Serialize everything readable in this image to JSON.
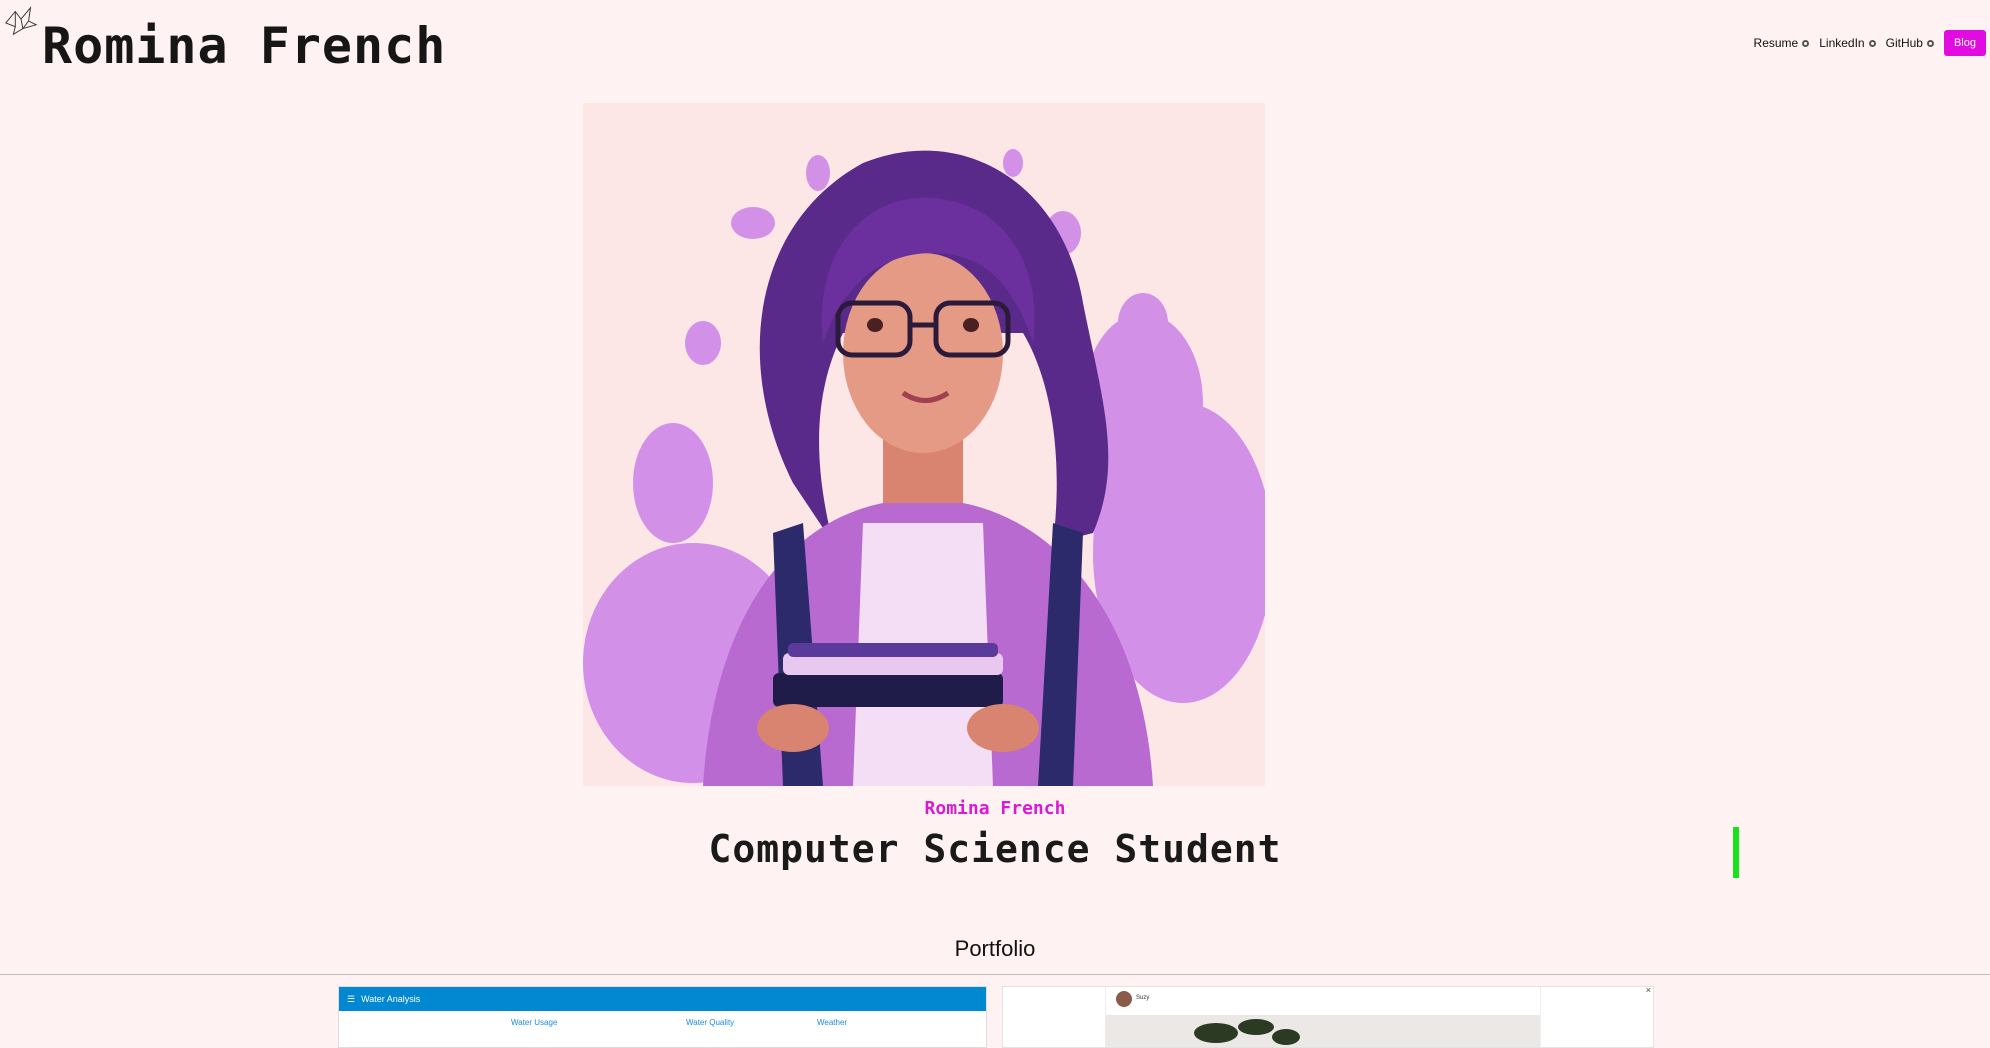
{
  "site": {
    "title": "Romina French"
  },
  "nav": {
    "resume": "Resume",
    "linkedin": "LinkedIn",
    "github": "GitHub",
    "blog": "Blog"
  },
  "hero": {
    "name": "Romina French",
    "role": "Computer Science Student"
  },
  "portfolio": {
    "heading": "Portfolio",
    "card1": {
      "title": "Water Analysis",
      "tabs": [
        "Water Usage",
        "Water Quality",
        "Weather"
      ]
    },
    "card2": {
      "username": "Suzy"
    }
  },
  "colors": {
    "background": "#fff2f3",
    "accent": "#e10de0",
    "cursor": "#17e31a",
    "card_bar": "#0288d1"
  }
}
